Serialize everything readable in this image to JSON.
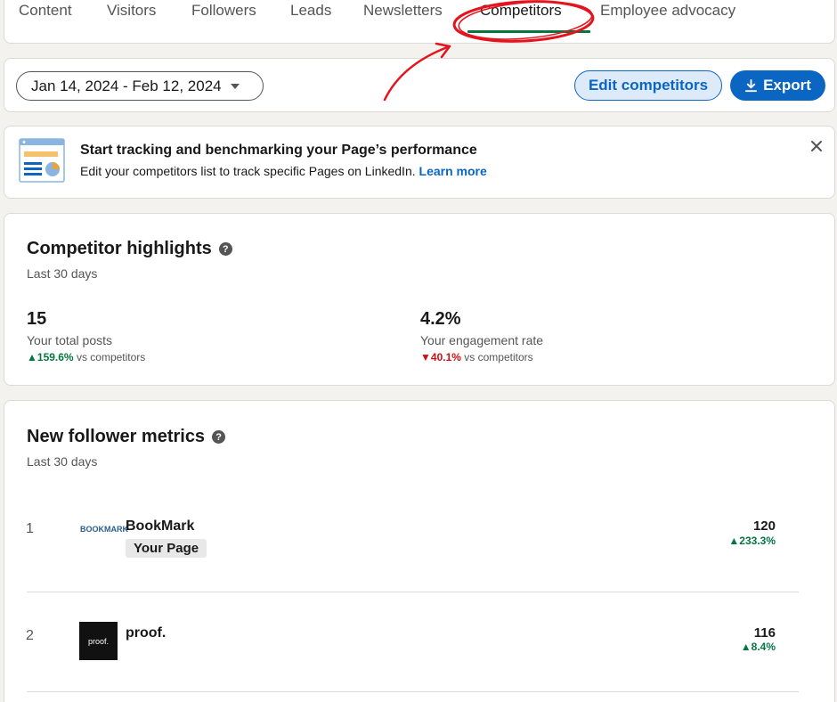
{
  "tabs": {
    "items": [
      "Content",
      "Visitors",
      "Followers",
      "Leads",
      "Newsletters",
      "Competitors",
      "Employee advocacy"
    ],
    "active": "Competitors"
  },
  "toolbar": {
    "date_range": "Jan 14, 2024 - Feb 12, 2024",
    "edit_label": "Edit competitors",
    "export_label": "Export"
  },
  "banner": {
    "title": "Start tracking and benchmarking your Page’s performance",
    "subtitle": "Edit your competitors list to track specific Pages on LinkedIn.",
    "link": "Learn more"
  },
  "highlights": {
    "title": "Competitor highlights",
    "period": "Last 30 days",
    "metrics": [
      {
        "value": "15",
        "label": "Your total posts",
        "change": "159.6%",
        "direction": "up",
        "suffix": "vs competitors"
      },
      {
        "value": "4.2%",
        "label": "Your engagement rate",
        "change": "40.1%",
        "direction": "down",
        "suffix": "vs competitors"
      }
    ]
  },
  "followers": {
    "title": "New follower metrics",
    "period": "Last 30 days",
    "rows": [
      {
        "rank": "1",
        "name": "BookMark",
        "badge": "Your Page",
        "logo_text": "BOOKMARK",
        "value": "120",
        "change": "233.3%"
      },
      {
        "rank": "2",
        "name": "proof.",
        "badge": "",
        "logo_text": "proof.",
        "value": "116",
        "change": "8.4%"
      }
    ]
  },
  "colors": {
    "primary": "#0a66c2",
    "positive": "#057642",
    "negative": "#cc1016",
    "annotation": "#e3141d"
  }
}
